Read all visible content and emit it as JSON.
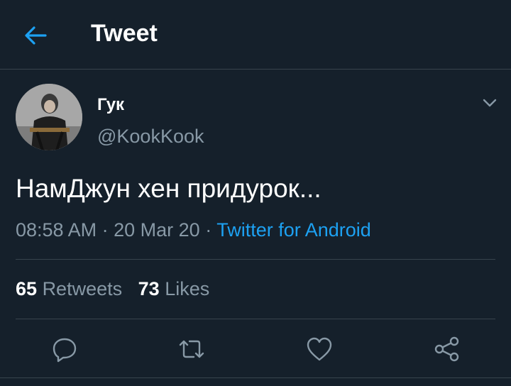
{
  "header": {
    "title": "Tweet",
    "back_icon": "arrow-left-icon",
    "accent": "#1da1f2"
  },
  "tweet": {
    "author": {
      "display_name": "Гук",
      "handle": "@KookKook"
    },
    "text": "НамДжун хен придурок...",
    "time": "08:58 AM",
    "date": "20 Mar 20",
    "separator": "·",
    "source": "Twitter for Android"
  },
  "stats": {
    "retweets_count": "65",
    "retweets_label": "Retweets",
    "likes_count": "73",
    "likes_label": "Likes"
  },
  "actions": [
    "reply-icon",
    "retweet-icon",
    "like-icon",
    "share-icon"
  ],
  "colors": {
    "background": "#15202b",
    "secondary_text": "#8899a6",
    "divider": "#38444d",
    "link": "#1da1f2"
  }
}
